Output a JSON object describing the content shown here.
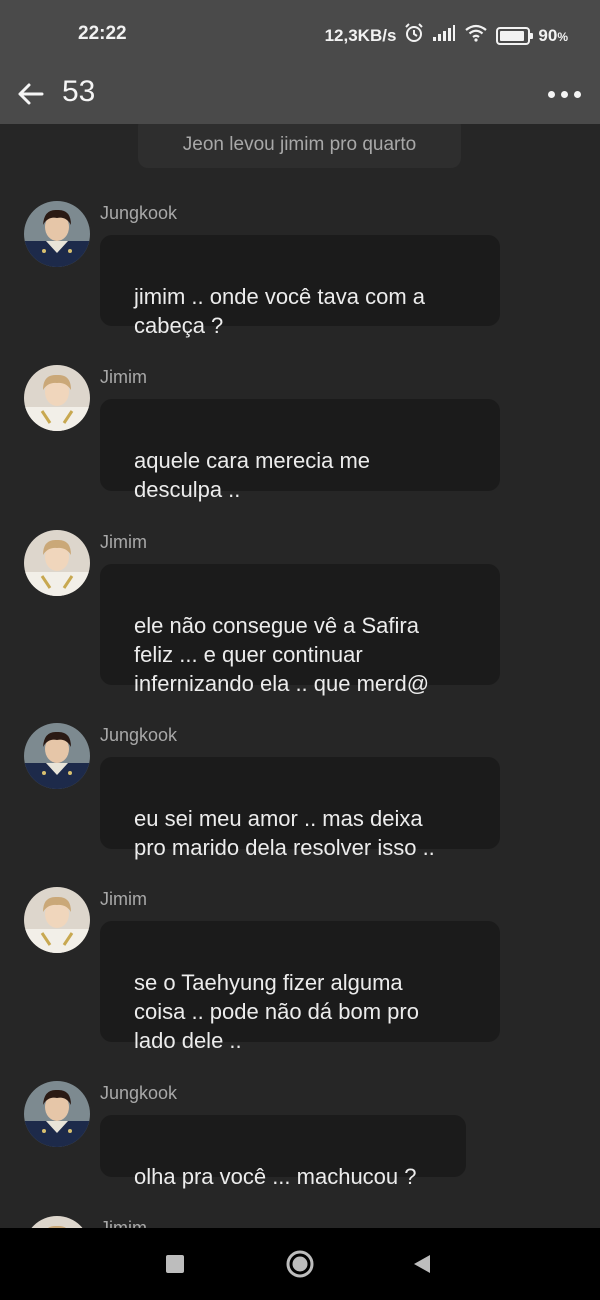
{
  "status_bar": {
    "time": "22:22",
    "network_speed": "12,3KB/s",
    "battery_percent": "90",
    "battery_suffix": "%",
    "icons": [
      "alarm-icon",
      "signal-icon",
      "wifi-icon",
      "battery-icon"
    ]
  },
  "app_bar": {
    "title": "53",
    "icons": [
      "back-arrow-icon",
      "more-options-icon"
    ]
  },
  "narration": "Jeon levou jimim pro quarto",
  "messages": [
    {
      "sender": "Jungkook",
      "text": "jimim .. onde você tava com a\ncabeça ?"
    },
    {
      "sender": "Jimim",
      "text": "aquele cara merecia me\ndesculpa .."
    },
    {
      "sender": "Jimim",
      "text": "ele não consegue vê a Safira\nfeliz ... e quer continuar\ninfernizando ela .. que merd@"
    },
    {
      "sender": "Jungkook",
      "text": "eu sei meu amor .. mas deixa\npro marido dela resolver isso .."
    },
    {
      "sender": "Jimim",
      "text": "se o Taehyung fizer alguma\ncoisa .. pode não dá bom pro\nlado dele .."
    },
    {
      "sender": "Jungkook",
      "text": "olha pra você ... machucou ?"
    },
    {
      "sender": "Jimim",
      "text": ""
    }
  ],
  "nav_bar": {
    "icons": [
      "square-icon",
      "home-circle-icon",
      "back-triangle-icon"
    ]
  },
  "colors": {
    "bars": "#4a4a4a",
    "background": "#262626",
    "bubble": "#1b1b1b",
    "text": "#ececec",
    "muted": "#a8a8a8"
  }
}
